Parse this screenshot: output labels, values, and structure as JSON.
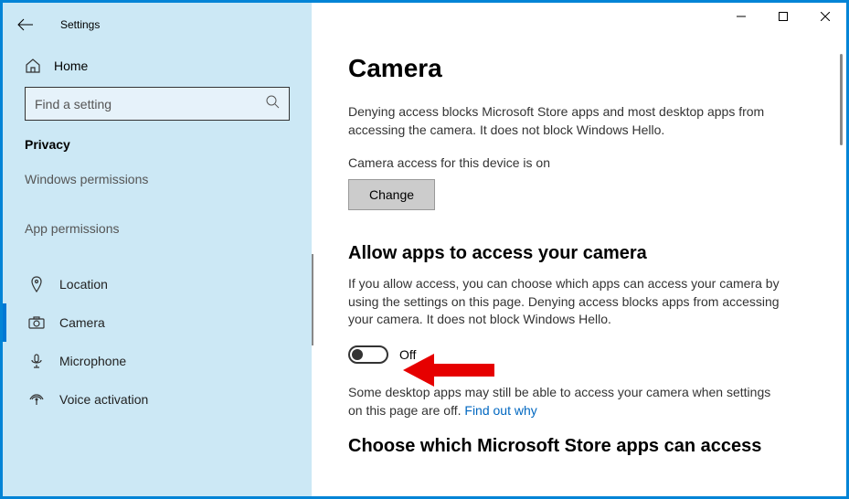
{
  "titlebar": {
    "back_title": "Settings"
  },
  "sidebar": {
    "home_label": "Home",
    "search_placeholder": "Find a setting",
    "category_label": "Privacy",
    "section_windows": "Windows permissions",
    "section_app": "App permissions",
    "items": [
      {
        "label": "Location"
      },
      {
        "label": "Camera"
      },
      {
        "label": "Microphone"
      },
      {
        "label": "Voice activation"
      }
    ]
  },
  "main": {
    "title": "Camera",
    "deny_desc": "Denying access blocks Microsoft Store apps and most desktop apps from accessing the camera. It does not block Windows Hello.",
    "device_access_text": "Camera access for this device is on",
    "change_label": "Change",
    "allow_heading": "Allow apps to access your camera",
    "allow_desc": "If you allow access, you can choose which apps can access your camera by using the settings on this page. Denying access blocks apps from accessing your camera. It does not block Windows Hello.",
    "toggle_state": "Off",
    "desktop_note_prefix": "Some desktop apps may still be able to access your camera when settings on this page are off. ",
    "desktop_note_link": "Find out why",
    "choose_heading": "Choose which Microsoft Store apps can access"
  }
}
